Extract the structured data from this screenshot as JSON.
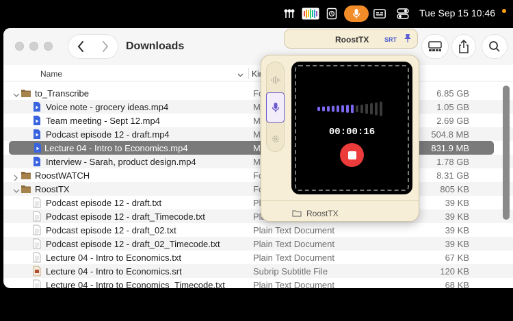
{
  "menubar": {
    "date": "Tue Sep 15",
    "time": "10:46",
    "icons": [
      "cluster-icon",
      "audio-meter-icon",
      "history-icon",
      "microphone-icon",
      "caption-icon",
      "control-center-icon"
    ]
  },
  "window": {
    "title": "Downloads",
    "columns": {
      "name": "Name",
      "kind": "Kind"
    }
  },
  "files": [
    {
      "name": "to_Transcribe",
      "kind": "Folder",
      "size": "6.85 GB",
      "type": "folder",
      "level": 0,
      "open": true
    },
    {
      "name": "Voice note - grocery ideas.mp4",
      "kind": "MPEG-4 movie",
      "size": "1.05 GB",
      "type": "video",
      "level": 1
    },
    {
      "name": "Team meeting - Sept 12.mp4",
      "kind": "MPEG-4 movie",
      "size": "2.69 GB",
      "type": "video",
      "level": 1
    },
    {
      "name": "Podcast episode 12 - draft.mp4",
      "kind": "MPEG-4 movie",
      "size": "504.8 MB",
      "type": "video",
      "level": 1
    },
    {
      "name": "Lecture 04 - Intro to Economics.mp4",
      "kind": "MPEG-4 movie",
      "size": "831.9 MB",
      "type": "video",
      "level": 1,
      "selected": true
    },
    {
      "name": "Interview - Sarah, product design.mp4",
      "kind": "MPEG-4 movie",
      "size": "1.78 GB",
      "type": "video",
      "level": 1
    },
    {
      "name": "RoostWATCH",
      "kind": "Folder",
      "size": "8.31 GB",
      "type": "folder",
      "level": 0,
      "open": false
    },
    {
      "name": "RoostTX",
      "kind": "Folder",
      "size": "805 KB",
      "type": "folder",
      "level": 0,
      "open": true
    },
    {
      "name": "Podcast episode 12 - draft.txt",
      "kind": "Plain Text Document",
      "size": "39 KB",
      "type": "text",
      "level": 1
    },
    {
      "name": "Podcast episode 12 - draft_Timecode.txt",
      "kind": "Plain Text Document",
      "size": "39 KB",
      "type": "text",
      "level": 1
    },
    {
      "name": "Podcast episode 12 - draft_02.txt",
      "kind": "Plain Text Document",
      "size": "39 KB",
      "type": "text",
      "level": 1
    },
    {
      "name": "Podcast episode 12 - draft_02_Timecode.txt",
      "kind": "Plain Text Document",
      "size": "39 KB",
      "type": "text",
      "level": 1
    },
    {
      "name": "Lecture 04 - Intro to Economics.txt",
      "kind": "Plain Text Document",
      "size": "67 KB",
      "type": "text",
      "level": 1
    },
    {
      "name": "Lecture 04 - Intro to Economics.srt",
      "kind": "Subrip Subtitle File",
      "size": "120 KB",
      "type": "srt",
      "level": 1
    },
    {
      "name": "Lecture 04 - Intro to Economics_Timecode.txt",
      "kind": "Plain Text Document",
      "size": "68 KB",
      "type": "text",
      "level": 1
    }
  ],
  "roosttx": {
    "title": "RoostTX",
    "badge": "SRT",
    "timer": "00:00:16",
    "folder": "RoostTX",
    "meter_level": 0.6,
    "colors": {
      "accent": "#7b68ee",
      "record": "#ec3b3b",
      "panel": "#f6eed6"
    }
  }
}
